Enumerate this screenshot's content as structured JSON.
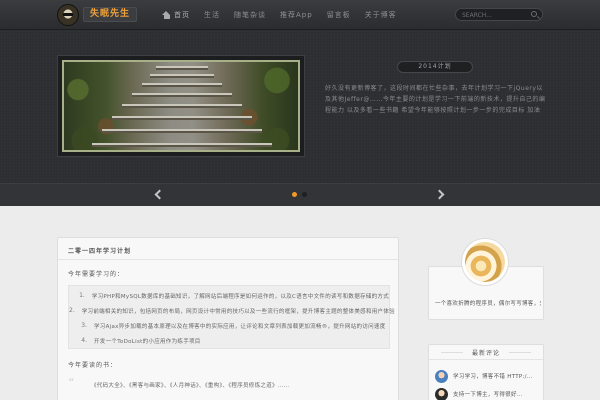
{
  "header": {
    "brand": "失眠先生",
    "nav": [
      {
        "label": "首页",
        "icon": "home-icon"
      },
      {
        "label": "生活"
      },
      {
        "label": "随笔杂谈"
      },
      {
        "label": "推荐App"
      },
      {
        "label": "留言板"
      },
      {
        "label": "关于博客"
      }
    ],
    "search_placeholder": "SEARCH..."
  },
  "slider": {
    "title": "2014计划",
    "text": "好久没有更新博客了，这段时间都在忙些杂事，去年计划学习一下jQuery以及其他Jeffer@……今年主要的计划是学习一下前端的新技术，提升自己的编程能力 以及多看一些书籍 希望今年能够按照计划一步一步的完成目标 加油",
    "dots": 2,
    "active_dot": 0
  },
  "post": {
    "title": "二零一四年学习计划",
    "section1": "今年需要学习的：",
    "items": [
      "学习PHP和MySQL数据库的基础知识，了解网站后端程序是如何运作的，以及C语言中文件的读写和数据存储的方式",
      "学习前端相关的知识，包括网页的布局，网页设计中常用的技巧以及一些流行的框架，提升博客主题的整体美感和用户体验",
      "学习Ajax异步加载的基本原理以及在博客中的实际应用，让评论和文章列表加载更加流畅®，提升网站的访问速度",
      "开发一个ToDoList的小应用作为练手项目"
    ],
    "section2": "今年要读的书：",
    "quote": "《代码大全》、《黑客与画家》、《人月神话》、《重构》、《程序员修炼之道》……"
  },
  "sidebar": {
    "profile_text": "一个喜欢折腾的程序员，偶尔写写博客，分享生活中的点滴。",
    "widget_title": "最新评论",
    "comments": [
      {
        "text": "学习学习，博客不错 HTTP:/..."
      },
      {
        "text": "支持一下博主，写得很好..."
      }
    ]
  },
  "colors": {
    "accent": "#f29a25",
    "brand_text": "#f0a23c"
  }
}
